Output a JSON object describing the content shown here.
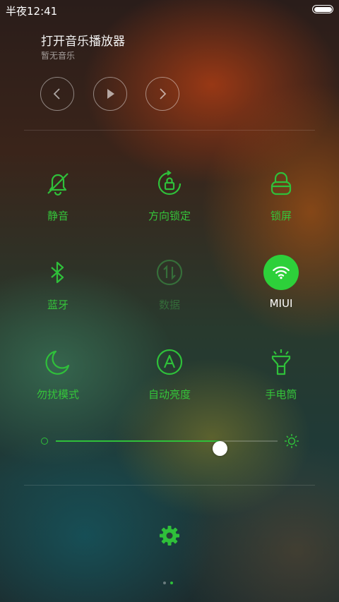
{
  "status_bar": {
    "time": "半夜12:41"
  },
  "music": {
    "title": "打开音乐播放器",
    "subtitle": "暂无音乐",
    "controls": [
      {
        "name": "previous-button",
        "icon": "chevron-left-icon"
      },
      {
        "name": "play-button",
        "icon": "play-icon"
      },
      {
        "name": "next-button",
        "icon": "chevron-right-icon"
      }
    ]
  },
  "toggles": [
    {
      "label": "静音",
      "icon": "bell-off-icon",
      "state": "on"
    },
    {
      "label": "方向锁定",
      "icon": "rotation-lock-icon",
      "state": "on"
    },
    {
      "label": "锁屏",
      "icon": "lock-icon",
      "state": "on"
    },
    {
      "label": "蓝牙",
      "icon": "bluetooth-icon",
      "state": "on"
    },
    {
      "label": "数据",
      "icon": "mobile-data-icon",
      "state": "disabled"
    },
    {
      "label": "MIUI",
      "icon": "wifi-icon",
      "state": "active"
    },
    {
      "label": "勿扰模式",
      "icon": "moon-icon",
      "state": "on"
    },
    {
      "label": "自动亮度",
      "icon": "auto-brightness-icon",
      "state": "on"
    },
    {
      "label": "手电筒",
      "icon": "flashlight-icon",
      "state": "on"
    }
  ],
  "brightness": {
    "level": 0.74
  },
  "settings": {
    "icon": "gear-icon"
  },
  "pager": {
    "pages": 2,
    "current": 2
  },
  "colors": {
    "accent": "#2fc03a",
    "active_bg": "#2dd03a"
  }
}
